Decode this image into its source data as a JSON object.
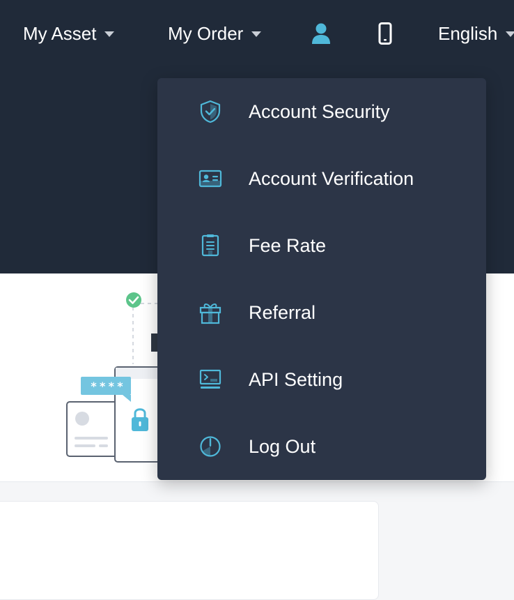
{
  "nav": {
    "my_asset": "My Asset",
    "my_order": "My Order",
    "language": "English",
    "icons": [
      "user-icon",
      "mobile-icon"
    ]
  },
  "account_menu": {
    "items": [
      {
        "label": "Account Security",
        "icon": "shield-icon"
      },
      {
        "label": "Account Verification",
        "icon": "id-card-icon"
      },
      {
        "label": "Fee Rate",
        "icon": "document-icon"
      },
      {
        "label": "Referral",
        "icon": "gift-icon"
      },
      {
        "label": "API Setting",
        "icon": "terminal-icon"
      },
      {
        "label": "Log Out",
        "icon": "power-icon"
      }
    ]
  },
  "illustration": {
    "password_mask": "****"
  },
  "colors": {
    "header_bg": "#202a39",
    "menu_bg": "#2c3547",
    "accent": "#4fb8d9",
    "success": "#5cc48a"
  }
}
